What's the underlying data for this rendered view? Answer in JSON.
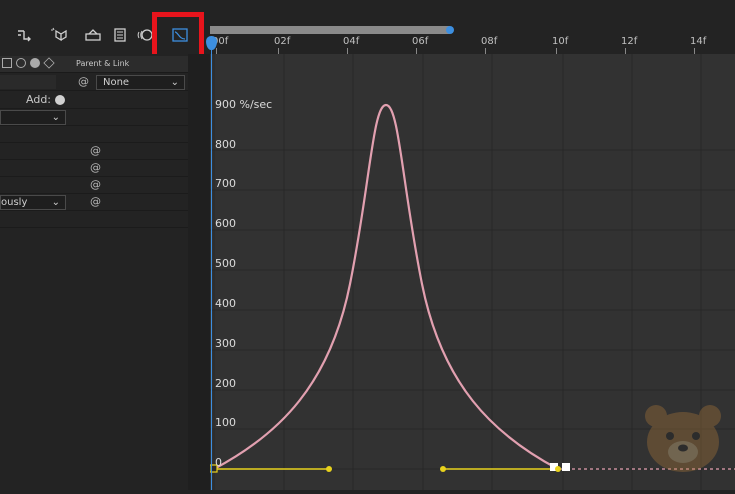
{
  "toolbar": {
    "icons": [
      "graph-link-icon",
      "solo-icon",
      "shy-icon",
      "frame-blend-icon",
      "motion-blur-icon",
      "graph-editor-icon"
    ],
    "highlight_color": "#e8141c"
  },
  "left_panel": {
    "parent_link_label": "Parent & Link",
    "parent_value": "None",
    "add_label": "Add:",
    "interpolation_partial": "ously"
  },
  "ruler": {
    "tick_labels": [
      "00f",
      "02f",
      "04f",
      "06f",
      "08f",
      "10f",
      "12f",
      "14f"
    ]
  },
  "graph": {
    "y_unit_label": "900 %/sec",
    "y_labels": [
      "800",
      "700",
      "600",
      "500",
      "400",
      "300",
      "200",
      "100",
      "0"
    ],
    "curve_color": "#e2a0b0",
    "keyframe_color": "#e8d21c",
    "playhead_color": "#3d8fe0"
  }
}
